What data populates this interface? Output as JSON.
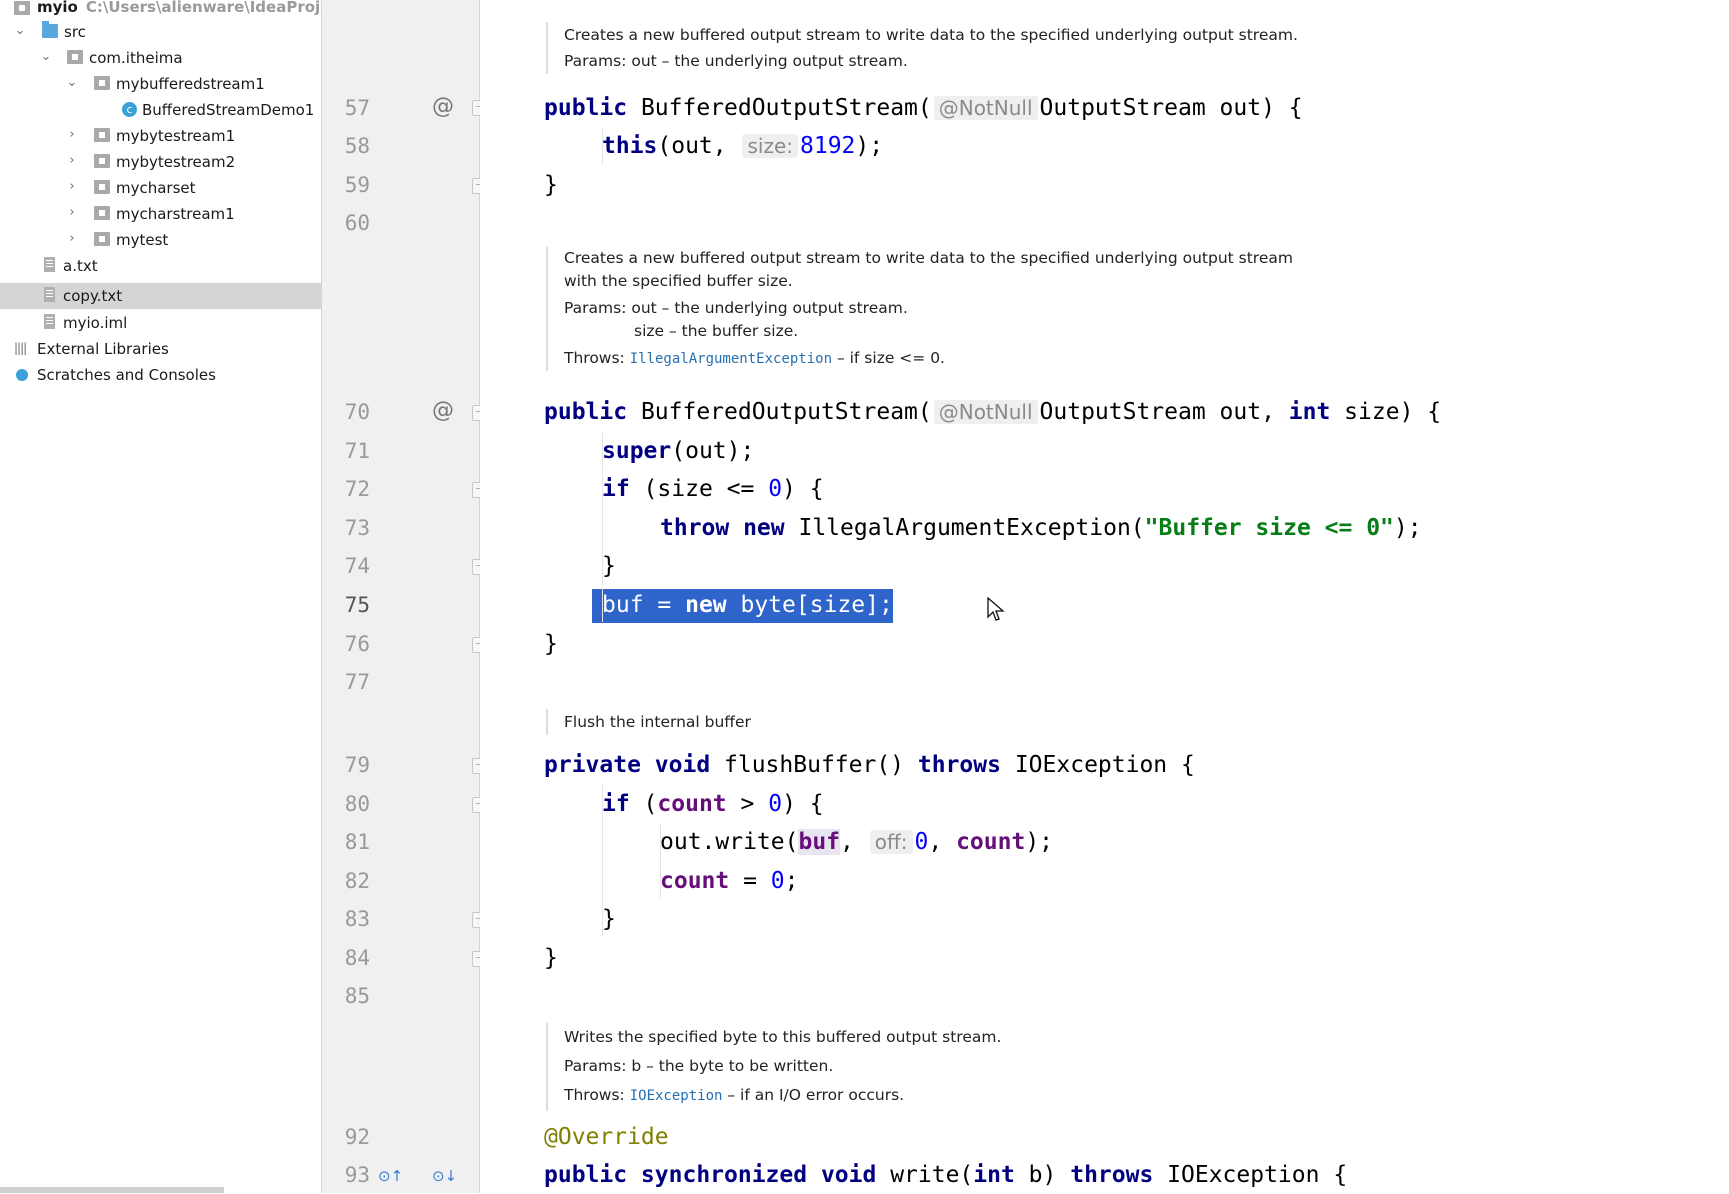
{
  "sidebar": {
    "project": {
      "name": "myio",
      "path": "C:\\Users\\alienware\\IdeaProject"
    },
    "items": [
      {
        "label": "src",
        "icon": "source-folder-icon"
      },
      {
        "label": "com.itheima",
        "icon": "package-icon"
      },
      {
        "label": "mybufferedstream1",
        "icon": "package-icon"
      },
      {
        "label": "BufferedStreamDemo1",
        "icon": "java-class-icon"
      },
      {
        "label": "mybytestream1",
        "icon": "package-icon"
      },
      {
        "label": "mybytestream2",
        "icon": "package-icon"
      },
      {
        "label": "mycharset",
        "icon": "package-icon"
      },
      {
        "label": "mycharstream1",
        "icon": "package-icon"
      },
      {
        "label": "mytest",
        "icon": "package-icon"
      },
      {
        "label": "a.txt",
        "icon": "text-file-icon"
      },
      {
        "label": "copy.txt",
        "icon": "text-file-icon"
      },
      {
        "label": "myio.iml",
        "icon": "module-file-icon"
      },
      {
        "label": "External Libraries",
        "icon": "libraries-icon"
      },
      {
        "label": "Scratches and Consoles",
        "icon": "scratches-icon"
      }
    ]
  },
  "gutter": {
    "lines": [
      "57",
      "58",
      "59",
      "60",
      "70",
      "71",
      "72",
      "73",
      "74",
      "75",
      "76",
      "77",
      "79",
      "80",
      "81",
      "82",
      "83",
      "84",
      "85",
      "92",
      "93"
    ],
    "override_marker": "@"
  },
  "docs": {
    "d1": {
      "line1": "Creates a new buffered output stream to write data to the specified underlying output stream.",
      "params": "Params: out – the underlying output stream."
    },
    "d2": {
      "line1": "Creates a new buffered output stream to write data to the specified underlying output stream",
      "line2": "with the specified buffer size.",
      "params1": "Params: out – the underlying output stream.",
      "params2": "size – the buffer size.",
      "throws_pre": "Throws: ",
      "throws_link": "IllegalArgumentException",
      "throws_post": " – if size <= 0."
    },
    "d3": {
      "line1": "Flush the internal buffer"
    },
    "d4": {
      "line1": "Writes the specified byte to this buffered output stream.",
      "params": "Params: b – the byte to be written.",
      "throws_pre": "Throws: ",
      "throws_link": "IOException",
      "throws_post": " – if an I/O error occurs."
    }
  },
  "code": {
    "l57": {
      "kw": "public",
      "name": " BufferedOutputStream(",
      "hint": "@NotNull",
      "rest": "OutputStream out) {"
    },
    "l58": {
      "kw": "this",
      "pre": "(out, ",
      "hint": "size:",
      "num": "8192",
      "post": ");"
    },
    "l59": "}",
    "l70": {
      "kw": "public",
      "name": " BufferedOutputStream(",
      "hint": "@NotNull",
      "rest1": "OutputStream out, ",
      "kw2": "int",
      "rest2": " size) {"
    },
    "l71": {
      "kw": "super",
      "rest": "(out);"
    },
    "l72": {
      "kw": "if",
      "pre": " (size <= ",
      "num": "0",
      "post": ") {"
    },
    "l73": {
      "kw": "throw new",
      "pre": " IllegalArgumentException(",
      "str": "\"Buffer size <= 0\"",
      "post": ");"
    },
    "l74": "}",
    "l75": {
      "field": "buf",
      "eq": " = ",
      "kw": "new",
      "rest": " byte[size];"
    },
    "l76": "}",
    "l79": {
      "kw1": "private void",
      "name": " flushBuffer() ",
      "kw2": "throws",
      "rest": " IOException {"
    },
    "l80": {
      "kw": "if",
      "pre": " (",
      "field": "count",
      "mid": " > ",
      "num": "0",
      "post": ") {"
    },
    "l81": {
      "pre": "out.write(",
      "field": "buf",
      "mid": ", ",
      "hint": "off:",
      "num": "0",
      "sep": ", ",
      "field2": "count",
      "post": ");"
    },
    "l82": {
      "field": "count",
      "mid": " = ",
      "num": "0",
      "post": ";"
    },
    "l83": "}",
    "l84": "}",
    "l92": "@Override",
    "l93": {
      "kw1": "public synchronized void",
      "name": " write(",
      "kw2": "int",
      "mid": " b) ",
      "kw3": "throws",
      "rest": " IOException {"
    }
  },
  "colors": {
    "keyword": "#000080",
    "number": "#0000ff",
    "string": "#067d17",
    "field": "#660e7a",
    "annotation": "#808000",
    "selection": "#2f65ca",
    "current_line": "#fffae3"
  }
}
